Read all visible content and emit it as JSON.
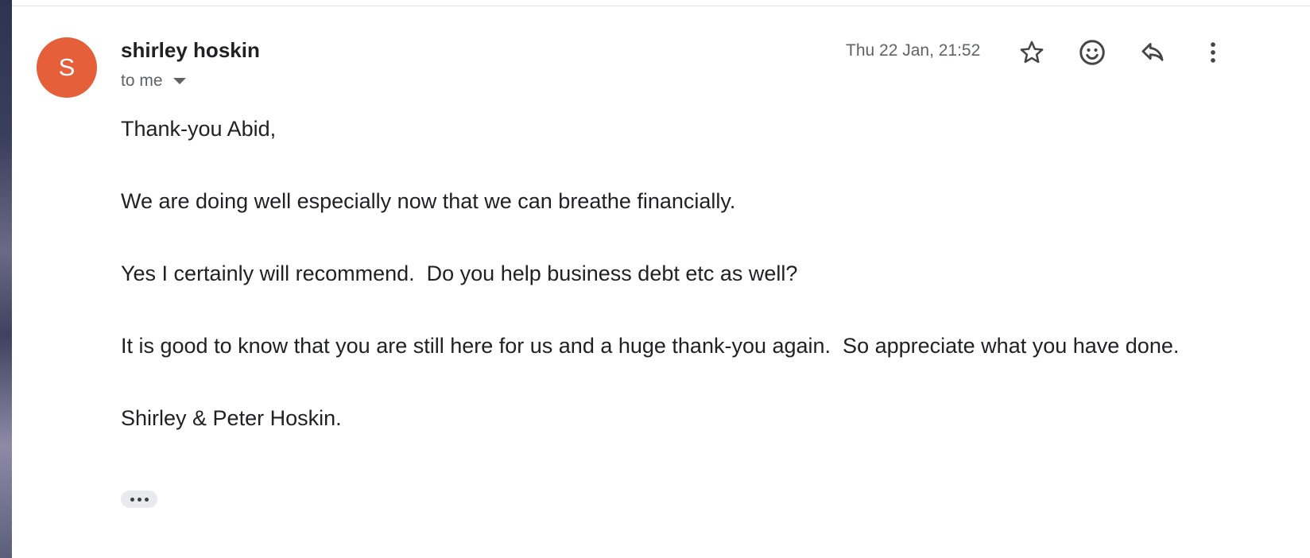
{
  "message": {
    "avatar_letter": "S",
    "avatar_color": "#e5603a",
    "sender_name": "shirley hoskin",
    "recipient_label": "to me",
    "timestamp": "Thu 22 Jan, 21:52",
    "body": {
      "greeting": "Thank-you Abid,",
      "paragraph_1": "We are doing well especially now that we can breathe financially.",
      "paragraph_2": "Yes I certainly will recommend.  Do you help business debt etc as well?",
      "paragraph_3": "It is good to know that you are still here for us and a huge thank-you again.  So appreciate what you have done.",
      "signature": "Shirley & Peter Hoskin."
    }
  },
  "actions": {
    "star": "star-icon",
    "emoji": "emoji-reaction-icon",
    "reply": "reply-icon",
    "more": "more-vert-icon",
    "recipient_details": "chevron-down-icon",
    "show_trimmed": "ellipsis-icon"
  }
}
